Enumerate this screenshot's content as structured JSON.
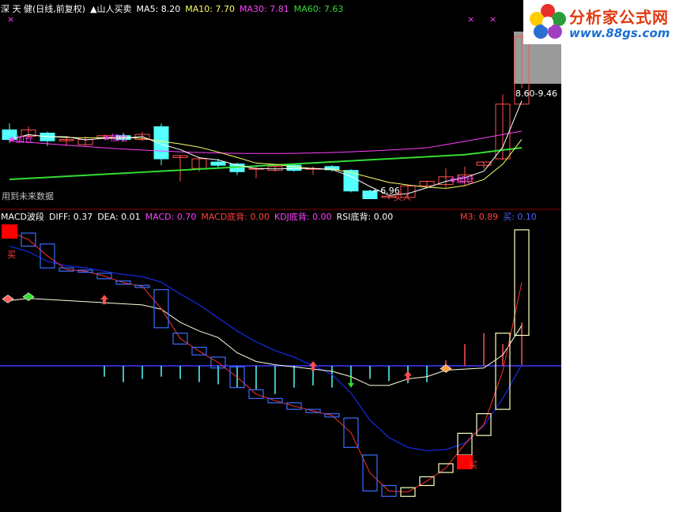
{
  "top_header": {
    "name": "深 天 健(日线,前复权)",
    "indicator": "▲山人买卖",
    "ma5": "MA5: 8.20",
    "ma10": "MA10: 7.70",
    "ma30": "MA30: 7.81",
    "ma60": "MA60: 7.63"
  },
  "bottom_header": {
    "title": "MACD波段",
    "diff": "DIFF: 0.37",
    "dea": "DEA: 0.01",
    "macd": "MACD: 0.70",
    "macd_div": "MACD底背: 0.00",
    "kdj_div": "KDJ底背: 0.00",
    "rsi_div": "RSI底背: 0.00",
    "m3": "M3: 0.89",
    "buy_val": "买: 0.10"
  },
  "annotations": {
    "future_note": "用到未来数据",
    "add_1": "★加仓",
    "add_2": "★加仓",
    "add_3": "★加仓",
    "low_price": "←6.96",
    "buy_in": "买入",
    "range_label": "8.60-9.46",
    "buy_mark_1": "买",
    "buy_mark_2": "买",
    "cross_mark": "×"
  },
  "logo": {
    "cn": "分析家公式网",
    "url": "www.88gs.com"
  },
  "colors": {
    "up": "#ff5050",
    "down": "#54ffff",
    "ma5": "#ffffff",
    "ma10": "#ffff66",
    "ma30": "#ff40ff",
    "ma60": "#33dd33",
    "macd_box_down": "#3a6dff",
    "macd_box_up": "#ffffc0",
    "dea": "#1428d8"
  },
  "chart_data": [
    {
      "type": "candlestick",
      "ylim": [
        6.8,
        9.6
      ],
      "candles": [
        {
          "o": 7.95,
          "h": 8.05,
          "l": 7.75,
          "c": 7.8
        },
        {
          "o": 7.85,
          "h": 8.0,
          "l": 7.82,
          "c": 7.95
        },
        {
          "o": 7.9,
          "h": 7.92,
          "l": 7.7,
          "c": 7.78
        },
        {
          "o": 7.78,
          "h": 7.85,
          "l": 7.7,
          "c": 7.8
        },
        {
          "o": 7.72,
          "h": 7.85,
          "l": 7.7,
          "c": 7.8
        },
        {
          "o": 7.82,
          "h": 7.88,
          "l": 7.8,
          "c": 7.86
        },
        {
          "o": 7.86,
          "h": 7.9,
          "l": 7.78,
          "c": 7.8
        },
        {
          "o": 7.8,
          "h": 7.92,
          "l": 7.78,
          "c": 7.88
        },
        {
          "o": 8.0,
          "h": 8.05,
          "l": 7.4,
          "c": 7.5
        },
        {
          "o": 7.52,
          "h": 7.56,
          "l": 7.15,
          "c": 7.55
        },
        {
          "o": 7.35,
          "h": 7.53,
          "l": 7.3,
          "c": 7.5
        },
        {
          "o": 7.45,
          "h": 7.5,
          "l": 7.35,
          "c": 7.4
        },
        {
          "o": 7.42,
          "h": 7.44,
          "l": 7.25,
          "c": 7.3
        },
        {
          "o": 7.35,
          "h": 7.38,
          "l": 7.2,
          "c": 7.35
        },
        {
          "o": 7.32,
          "h": 7.42,
          "l": 7.3,
          "c": 7.38
        },
        {
          "o": 7.4,
          "h": 7.42,
          "l": 7.3,
          "c": 7.32
        },
        {
          "o": 7.34,
          "h": 7.38,
          "l": 7.25,
          "c": 7.35
        },
        {
          "o": 7.38,
          "h": 7.4,
          "l": 7.3,
          "c": 7.33
        },
        {
          "o": 7.32,
          "h": 7.34,
          "l": 6.98,
          "c": 7.0
        },
        {
          "o": 7.0,
          "h": 7.02,
          "l": 6.96,
          "c": 6.88
        },
        {
          "o": 6.9,
          "h": 6.92,
          "l": 6.87,
          "c": 6.92
        },
        {
          "o": 6.9,
          "h": 7.1,
          "l": 6.88,
          "c": 7.08
        },
        {
          "o": 7.08,
          "h": 7.16,
          "l": 7.05,
          "c": 7.15
        },
        {
          "o": 7.1,
          "h": 7.35,
          "l": 7.05,
          "c": 7.22
        },
        {
          "o": 7.15,
          "h": 7.38,
          "l": 7.08,
          "c": 7.25
        },
        {
          "o": 7.4,
          "h": 7.45,
          "l": 7.35,
          "c": 7.45
        },
        {
          "o": 7.5,
          "h": 8.5,
          "l": 7.48,
          "c": 8.35
        },
        {
          "o": 8.35,
          "h": 9.46,
          "l": 8.6,
          "c": 9.4
        }
      ]
    },
    {
      "type": "macd_wave",
      "ylim": [
        -1.3,
        1.3
      ],
      "boxes": [
        {
          "o": 1.25,
          "c": 1.22
        },
        {
          "o": 1.22,
          "c": 1.1
        },
        {
          "o": 1.12,
          "c": 0.9
        },
        {
          "o": 0.9,
          "c": 0.87
        },
        {
          "o": 0.88,
          "c": 0.86
        },
        {
          "o": 0.85,
          "c": 0.8
        },
        {
          "o": 0.78,
          "c": 0.75
        },
        {
          "o": 0.74,
          "c": 0.72
        },
        {
          "o": 0.7,
          "c": 0.35
        },
        {
          "o": 0.3,
          "c": 0.2
        },
        {
          "o": 0.17,
          "c": 0.1
        },
        {
          "o": 0.08,
          "c": -0.02
        },
        {
          "o": -0.01,
          "c": -0.2
        },
        {
          "o": -0.22,
          "c": -0.3
        },
        {
          "o": -0.3,
          "c": -0.34
        },
        {
          "o": -0.34,
          "c": -0.4
        },
        {
          "o": -0.4,
          "c": -0.43
        },
        {
          "o": -0.44,
          "c": -0.47
        },
        {
          "o": -0.48,
          "c": -0.75
        },
        {
          "o": -0.82,
          "c": -1.15
        },
        {
          "o": -1.1,
          "c": -1.2
        },
        {
          "o": -1.2,
          "c": -1.12
        },
        {
          "o": -1.1,
          "c": -1.02
        },
        {
          "o": -0.98,
          "c": -0.9
        },
        {
          "o": -0.82,
          "c": -0.62
        },
        {
          "o": -0.64,
          "c": -0.44
        },
        {
          "o": -0.4,
          "c": 0.3
        },
        {
          "o": 0.28,
          "c": 1.25
        }
      ],
      "diff": [
        0.6,
        0.62,
        0.61,
        0.6,
        0.59,
        0.58,
        0.57,
        0.56,
        0.52,
        0.4,
        0.32,
        0.26,
        0.12,
        0.04,
        0.01,
        -0.01,
        -0.03,
        -0.05,
        -0.1,
        -0.18,
        -0.18,
        -0.12,
        -0.1,
        -0.04,
        -0.03,
        -0.02,
        0.1,
        0.37
      ],
      "dea": [
        1.1,
        1.05,
        0.96,
        0.92,
        0.9,
        0.87,
        0.84,
        0.82,
        0.77,
        0.66,
        0.56,
        0.44,
        0.32,
        0.22,
        0.14,
        0.08,
        0.0,
        -0.08,
        -0.25,
        -0.5,
        -0.66,
        -0.75,
        -0.78,
        -0.77,
        -0.71,
        -0.55,
        -0.3,
        0.01
      ],
      "hist": [
        0.0,
        0.0,
        0.0,
        0.0,
        0.0,
        -0.1,
        -0.15,
        -0.12,
        -0.1,
        -0.12,
        -0.15,
        -0.17,
        -0.2,
        -0.22,
        -0.26,
        -0.2,
        -0.18,
        -0.2,
        -0.16,
        -0.12,
        -0.14,
        -0.16,
        -0.15,
        0.05,
        0.2,
        0.3,
        0.2,
        0.4
      ]
    }
  ]
}
